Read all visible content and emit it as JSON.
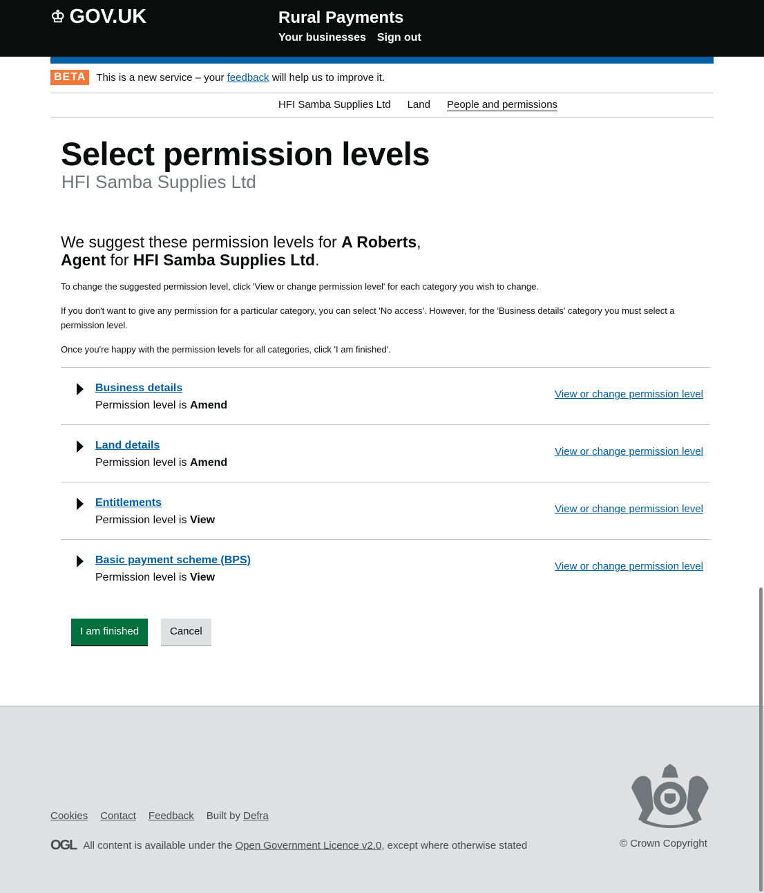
{
  "header": {
    "logo": "GOV.UK",
    "service": "Rural Payments",
    "nav": [
      "Your businesses",
      "Sign out"
    ]
  },
  "beta": {
    "tag": "BETA",
    "text_before": "This is a new service – your",
    "link": "feedback",
    "text_after": "will help us to improve it."
  },
  "subnav": [
    "HFI Samba Supplies Ltd",
    "Land",
    "People and permissions"
  ],
  "page": {
    "title": "Select permission levels",
    "caption": "HFI Samba Supplies Ltd",
    "intro": {
      "a": "We suggest these permission levels for ",
      "name": "A Roberts",
      "b": ",",
      "role": "Agent",
      "c": " for ",
      "business": "HFI Samba Supplies Ltd",
      "d": "."
    },
    "paras": [
      "To change the suggested permission level, click 'View or change permission level' for each category you wish to change.",
      "If you don't want to give any permission for a particular category, you can select 'No access'. However, for the 'Business details' category you must select a permission level.",
      "Once you're happy with the permission levels for all categories, click 'I am finished'."
    ]
  },
  "rows": [
    {
      "title": "Business details",
      "prefix": "Permission level is ",
      "level": "Amend",
      "action": "View or change permission level"
    },
    {
      "title": "Land details",
      "prefix": "Permission level is ",
      "level": "Amend",
      "action": "View or change permission level"
    },
    {
      "title": "Entitlements",
      "prefix": "Permission level is ",
      "level": "View",
      "action": "View or change permission level"
    },
    {
      "title": "Basic payment scheme (BPS)",
      "prefix": "Permission level is ",
      "level": "View",
      "action": "View or change permission level"
    }
  ],
  "buttons": {
    "finish": "I am finished",
    "cancel": "Cancel"
  },
  "footer": {
    "links": [
      "Cookies",
      "Contact",
      "Feedback"
    ],
    "built_by": "Built by",
    "built_link": "Defra",
    "ogl": "OGL",
    "lic_before": "All content is available under the",
    "lic_link": "Open Government Licence v2.0",
    "lic_after": ", except where otherwise stated",
    "copyright": "© Crown Copyright"
  }
}
